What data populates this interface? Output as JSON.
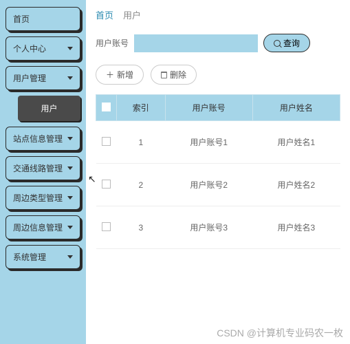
{
  "sidebar": {
    "items": [
      {
        "label": "首页",
        "expandable": false
      },
      {
        "label": "个人中心",
        "expandable": true
      },
      {
        "label": "用户管理",
        "expandable": true
      },
      {
        "label": "用户",
        "sub": true
      },
      {
        "label": "站点信息管理",
        "expandable": true
      },
      {
        "label": "交通线路管理",
        "expandable": true
      },
      {
        "label": "周边类型管理",
        "expandable": true
      },
      {
        "label": "周边信息管理",
        "expandable": true
      },
      {
        "label": "系统管理",
        "expandable": true
      }
    ]
  },
  "breadcrumb": {
    "root": "首页",
    "current": "用户"
  },
  "filter": {
    "label": "用户账号",
    "value": "",
    "search_label": "查询"
  },
  "actions": {
    "add": "新增",
    "delete": "删除"
  },
  "table": {
    "headers": [
      "",
      "索引",
      "用户账号",
      "用户姓名"
    ],
    "rows": [
      {
        "index": "1",
        "account": "用户账号1",
        "name": "用户姓名1"
      },
      {
        "index": "2",
        "account": "用户账号2",
        "name": "用户姓名2"
      },
      {
        "index": "3",
        "account": "用户账号3",
        "name": "用户姓名3"
      }
    ]
  },
  "watermark": "CSDN @计算机专业码农一枚"
}
